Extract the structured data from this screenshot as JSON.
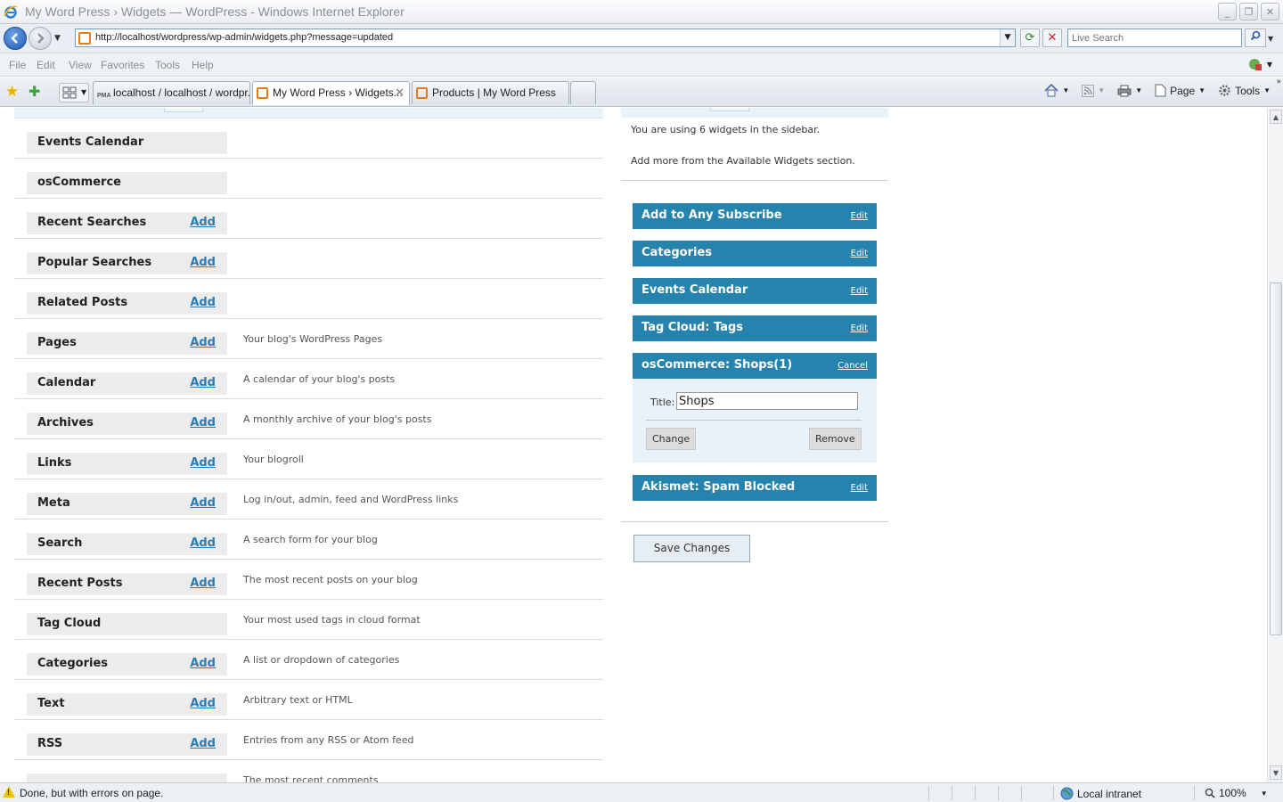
{
  "window": {
    "title": "My Word Press › Widgets — WordPress - Windows Internet Explorer"
  },
  "address_bar": {
    "url": "http://localhost/wordpress/wp-admin/widgets.php?message=updated",
    "search_placeholder": "Live Search"
  },
  "menu": {
    "items": [
      "File",
      "Edit",
      "View",
      "Favorites",
      "Tools",
      "Help"
    ]
  },
  "tabs": [
    {
      "label": "localhost / localhost / wordpr...",
      "icon": "phpmyadmin-icon",
      "active": false
    },
    {
      "label": "My Word Press › Widgets...",
      "icon": "wordpress-page-icon",
      "active": true
    },
    {
      "label": "Products | My Word Press",
      "icon": "wordpress-page-icon",
      "active": false
    }
  ],
  "command_bar": {
    "page_label": "Page",
    "tools_label": "Tools"
  },
  "available_widgets": [
    {
      "name": "Events Calendar",
      "add": "",
      "description": ""
    },
    {
      "name": "osCommerce",
      "add": "",
      "description": ""
    },
    {
      "name": "Recent Searches",
      "add": "Add",
      "description": ""
    },
    {
      "name": "Popular Searches",
      "add": "Add",
      "description": ""
    },
    {
      "name": "Related Posts",
      "add": "Add",
      "description": ""
    },
    {
      "name": "Pages",
      "add": "Add",
      "description": "Your blog's WordPress Pages"
    },
    {
      "name": "Calendar",
      "add": "Add",
      "description": "A calendar of your blog's posts"
    },
    {
      "name": "Archives",
      "add": "Add",
      "description": "A monthly archive of your blog's posts"
    },
    {
      "name": "Links",
      "add": "Add",
      "description": "Your blogroll"
    },
    {
      "name": "Meta",
      "add": "Add",
      "description": "Log in/out, admin, feed and WordPress links"
    },
    {
      "name": "Search",
      "add": "Add",
      "description": "A search form for your blog"
    },
    {
      "name": "Recent Posts",
      "add": "Add",
      "description": "The most recent posts on your blog"
    },
    {
      "name": "Tag Cloud",
      "add": "",
      "description": "Your most used tags in cloud format"
    },
    {
      "name": "Categories",
      "add": "Add",
      "description": "A list or dropdown of categories"
    },
    {
      "name": "Text",
      "add": "Add",
      "description": "Arbitrary text or HTML"
    },
    {
      "name": "RSS",
      "add": "Add",
      "description": "Entries from any RSS or Atom feed"
    },
    {
      "name": "",
      "add": "",
      "description": "The most recent comments"
    }
  ],
  "sidebar": {
    "info_line_1": "You are using 6 widgets in the sidebar.",
    "info_line_2": "Add more from the Available Widgets section.",
    "widgets": [
      {
        "name": "Add to Any Subscribe",
        "action": "Edit"
      },
      {
        "name": "Categories",
        "action": "Edit"
      },
      {
        "name": "Events Calendar",
        "action": "Edit"
      },
      {
        "name": "Tag Cloud: Tags",
        "action": "Edit"
      },
      {
        "name": "osCommerce: Shops(1)",
        "action": "Cancel"
      },
      {
        "name": "Akismet: Spam Blocked",
        "action": "Edit"
      }
    ],
    "edit_form": {
      "title_label": "Title:",
      "title_value": "Shops",
      "change_label": "Change",
      "remove_label": "Remove"
    },
    "save_label": "Save Changes"
  },
  "status_bar": {
    "message": "Done, but with errors on page.",
    "zone": "Local intranet",
    "zoom": "100%"
  }
}
